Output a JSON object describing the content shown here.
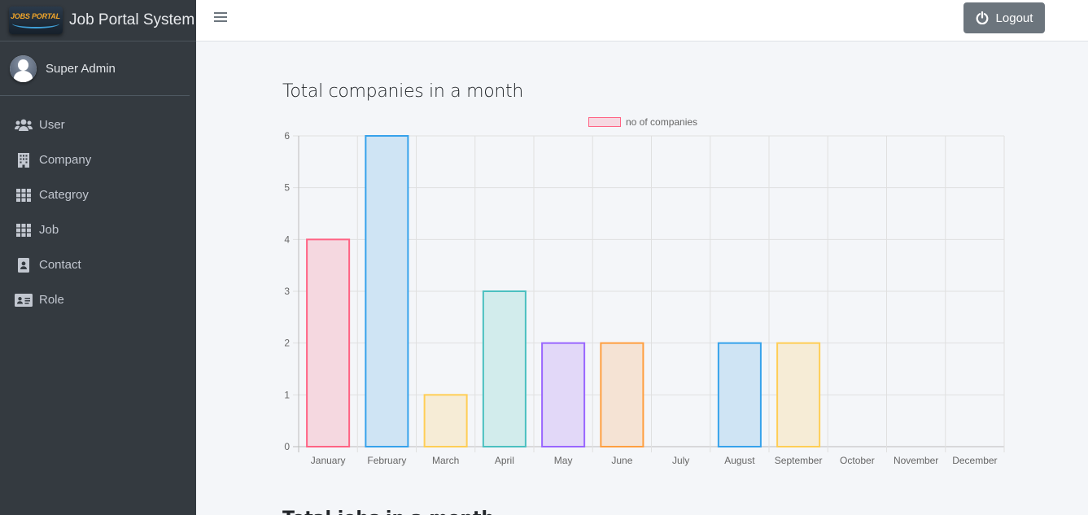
{
  "brand": {
    "logo_text": "JOBS PORTAL",
    "title": "Job Portal System"
  },
  "user": {
    "name": "Super Admin"
  },
  "sidebar": {
    "items": [
      {
        "label": "User",
        "icon": "users-icon"
      },
      {
        "label": "Company",
        "icon": "building-icon"
      },
      {
        "label": "Categroy",
        "icon": "grid-icon"
      },
      {
        "label": "Job",
        "icon": "grid-icon"
      },
      {
        "label": "Contact",
        "icon": "contact-icon"
      },
      {
        "label": "Role",
        "icon": "id-card-icon"
      }
    ]
  },
  "header": {
    "logout_label": "Logout"
  },
  "main": {
    "chart_title": "Total companies in a month",
    "next_title": "Total jobs in a month"
  },
  "chart_data": {
    "type": "bar",
    "categories": [
      "January",
      "February",
      "March",
      "April",
      "May",
      "June",
      "July",
      "August",
      "September",
      "October",
      "November",
      "December"
    ],
    "series": [
      {
        "name": "no of companies",
        "values": [
          4,
          6,
          1,
          3,
          2,
          2,
          0,
          2,
          2,
          0,
          0,
          0
        ]
      }
    ],
    "ylim": [
      0,
      6
    ],
    "yticks": [
      0,
      1,
      2,
      3,
      4,
      5,
      6
    ],
    "legend": "top-center",
    "grid": true,
    "bar_colors": [
      {
        "fill": "#f5d8e0",
        "stroke": "#ff6384"
      },
      {
        "fill": "#cfe4f4",
        "stroke": "#36a2eb"
      },
      {
        "fill": "#f6ecd6",
        "stroke": "#ffce56"
      },
      {
        "fill": "#d2ecec",
        "stroke": "#4bc0c0"
      },
      {
        "fill": "#e2d8f8",
        "stroke": "#9966ff"
      },
      {
        "fill": "#f5e3d4",
        "stroke": "#ff9f40"
      },
      {
        "fill": "#f5d8e0",
        "stroke": "#ff6384"
      },
      {
        "fill": "#cfe4f4",
        "stroke": "#36a2eb"
      },
      {
        "fill": "#f6ecd6",
        "stroke": "#ffce56"
      },
      {
        "fill": "#d2ecec",
        "stroke": "#4bc0c0"
      },
      {
        "fill": "#e2d8f8",
        "stroke": "#9966ff"
      },
      {
        "fill": "#f5e3d4",
        "stroke": "#ff9f40"
      }
    ],
    "legend_color": {
      "fill": "#f5d8e0",
      "stroke": "#ff6384"
    }
  },
  "colors": {
    "sidebar_bg": "#343a40",
    "content_bg": "#f4f6f9",
    "logout_bg": "#6c757d"
  }
}
